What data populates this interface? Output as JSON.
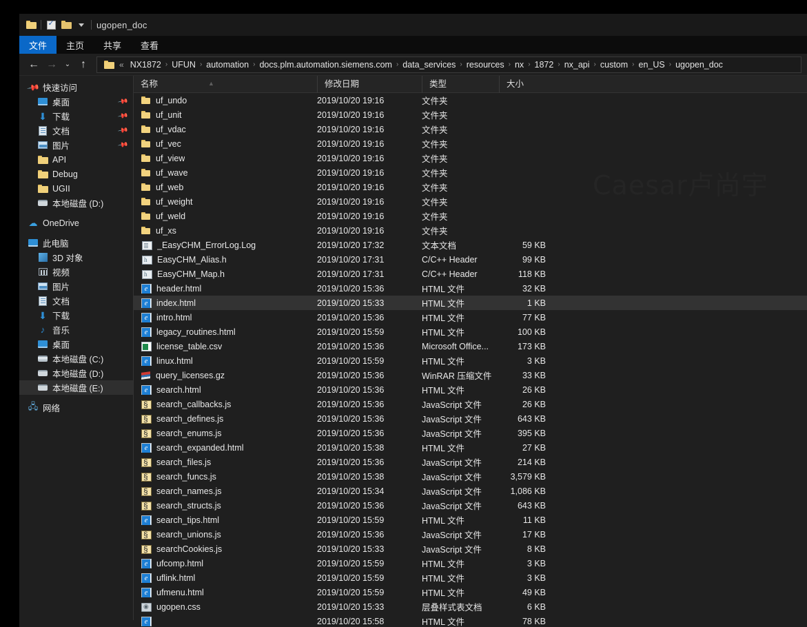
{
  "window": {
    "title": "ugopen_doc",
    "quick_access": [
      {
        "name": "folder-icon",
        "label": "folder"
      },
      {
        "name": "properties-checkbox-icon",
        "label": "properties"
      },
      {
        "name": "new-folder-icon",
        "label": "new folder"
      },
      {
        "name": "customize-qat-caret-icon",
        "label": "customize"
      }
    ]
  },
  "ribbon": {
    "tabs": [
      {
        "label": "文件",
        "active": true
      },
      {
        "label": "主页",
        "active": false
      },
      {
        "label": "共享",
        "active": false
      },
      {
        "label": "查看",
        "active": false
      }
    ]
  },
  "address": {
    "back_icon": "←",
    "forward_icon": "→",
    "history_icon": "⌄",
    "up_icon": "↑",
    "overflow": "«",
    "separator": "›",
    "crumbs": [
      "NX1872",
      "UFUN",
      "automation",
      "docs.plm.automation.siemens.com",
      "data_services",
      "resources",
      "nx",
      "1872",
      "nx_api",
      "custom",
      "en_US",
      "ugopen_doc"
    ]
  },
  "sidebar": {
    "groups": [
      {
        "header": {
          "label": "快速访问",
          "icon": "pin-icon"
        },
        "items": [
          {
            "label": "桌面",
            "icon": "desktop-icon",
            "pinned": true
          },
          {
            "label": "下载",
            "icon": "downloads-icon",
            "pinned": true
          },
          {
            "label": "文档",
            "icon": "documents-icon",
            "pinned": true
          },
          {
            "label": "图片",
            "icon": "pictures-icon",
            "pinned": true
          },
          {
            "label": "API",
            "icon": "folder-icon",
            "pinned": false
          },
          {
            "label": "Debug",
            "icon": "folder-icon",
            "pinned": false
          },
          {
            "label": "UGII",
            "icon": "folder-icon",
            "pinned": false
          },
          {
            "label": "本地磁盘 (D:)",
            "icon": "drive-icon",
            "pinned": false
          }
        ]
      },
      {
        "header": {
          "label": "OneDrive",
          "icon": "cloud-icon"
        },
        "items": []
      },
      {
        "header": {
          "label": "此电脑",
          "icon": "this-pc-icon"
        },
        "items": [
          {
            "label": "3D 对象",
            "icon": "3d-objects-icon",
            "pinned": false
          },
          {
            "label": "视频",
            "icon": "videos-icon",
            "pinned": false
          },
          {
            "label": "图片",
            "icon": "pictures-icon",
            "pinned": false
          },
          {
            "label": "文档",
            "icon": "documents-icon",
            "pinned": false
          },
          {
            "label": "下载",
            "icon": "downloads-icon",
            "pinned": false
          },
          {
            "label": "音乐",
            "icon": "music-icon",
            "pinned": false
          },
          {
            "label": "桌面",
            "icon": "desktop-icon",
            "pinned": false
          },
          {
            "label": "本地磁盘 (C:)",
            "icon": "system-drive-icon",
            "pinned": false
          },
          {
            "label": "本地磁盘 (D:)",
            "icon": "drive-icon",
            "pinned": false
          },
          {
            "label": "本地磁盘 (E:)",
            "icon": "drive-icon",
            "pinned": false,
            "selected": true
          }
        ]
      },
      {
        "header": {
          "label": "网络",
          "icon": "network-icon"
        },
        "items": []
      }
    ]
  },
  "file_list": {
    "columns": [
      {
        "label": "名称",
        "key": "name",
        "sorted": "asc"
      },
      {
        "label": "修改日期",
        "key": "date"
      },
      {
        "label": "类型",
        "key": "type"
      },
      {
        "label": "大小",
        "key": "size"
      }
    ],
    "rows": [
      {
        "name": "uf_undo",
        "date": "2019/10/20 19:16",
        "type": "文件夹",
        "size": "",
        "icon": "folder"
      },
      {
        "name": "uf_unit",
        "date": "2019/10/20 19:16",
        "type": "文件夹",
        "size": "",
        "icon": "folder"
      },
      {
        "name": "uf_vdac",
        "date": "2019/10/20 19:16",
        "type": "文件夹",
        "size": "",
        "icon": "folder"
      },
      {
        "name": "uf_vec",
        "date": "2019/10/20 19:16",
        "type": "文件夹",
        "size": "",
        "icon": "folder"
      },
      {
        "name": "uf_view",
        "date": "2019/10/20 19:16",
        "type": "文件夹",
        "size": "",
        "icon": "folder"
      },
      {
        "name": "uf_wave",
        "date": "2019/10/20 19:16",
        "type": "文件夹",
        "size": "",
        "icon": "folder"
      },
      {
        "name": "uf_web",
        "date": "2019/10/20 19:16",
        "type": "文件夹",
        "size": "",
        "icon": "folder"
      },
      {
        "name": "uf_weight",
        "date": "2019/10/20 19:16",
        "type": "文件夹",
        "size": "",
        "icon": "folder"
      },
      {
        "name": "uf_weld",
        "date": "2019/10/20 19:16",
        "type": "文件夹",
        "size": "",
        "icon": "folder"
      },
      {
        "name": "uf_xs",
        "date": "2019/10/20 19:16",
        "type": "文件夹",
        "size": "",
        "icon": "folder"
      },
      {
        "name": "_EasyCHM_ErrorLog.Log",
        "date": "2019/10/20 17:32",
        "type": "文本文档",
        "size": "59 KB",
        "icon": "txt"
      },
      {
        "name": "EasyCHM_Alias.h",
        "date": "2019/10/20 17:31",
        "type": "C/C++ Header",
        "size": "99 KB",
        "icon": "h"
      },
      {
        "name": "EasyCHM_Map.h",
        "date": "2019/10/20 17:31",
        "type": "C/C++ Header",
        "size": "118 KB",
        "icon": "h"
      },
      {
        "name": "header.html",
        "date": "2019/10/20 15:36",
        "type": "HTML 文件",
        "size": "32 KB",
        "icon": "html"
      },
      {
        "name": "index.html",
        "date": "2019/10/20 15:33",
        "type": "HTML 文件",
        "size": "1 KB",
        "icon": "html",
        "selected": true
      },
      {
        "name": "intro.html",
        "date": "2019/10/20 15:36",
        "type": "HTML 文件",
        "size": "77 KB",
        "icon": "html"
      },
      {
        "name": "legacy_routines.html",
        "date": "2019/10/20 15:59",
        "type": "HTML 文件",
        "size": "100 KB",
        "icon": "html"
      },
      {
        "name": "license_table.csv",
        "date": "2019/10/20 15:36",
        "type": "Microsoft Office...",
        "size": "173 KB",
        "icon": "csv"
      },
      {
        "name": "linux.html",
        "date": "2019/10/20 15:59",
        "type": "HTML 文件",
        "size": "3 KB",
        "icon": "html"
      },
      {
        "name": "query_licenses.gz",
        "date": "2019/10/20 15:36",
        "type": "WinRAR 压缩文件",
        "size": "33 KB",
        "icon": "gz"
      },
      {
        "name": "search.html",
        "date": "2019/10/20 15:36",
        "type": "HTML 文件",
        "size": "26 KB",
        "icon": "html"
      },
      {
        "name": "search_callbacks.js",
        "date": "2019/10/20 15:36",
        "type": "JavaScript 文件",
        "size": "26 KB",
        "icon": "js"
      },
      {
        "name": "search_defines.js",
        "date": "2019/10/20 15:36",
        "type": "JavaScript 文件",
        "size": "643 KB",
        "icon": "js"
      },
      {
        "name": "search_enums.js",
        "date": "2019/10/20 15:36",
        "type": "JavaScript 文件",
        "size": "395 KB",
        "icon": "js"
      },
      {
        "name": "search_expanded.html",
        "date": "2019/10/20 15:38",
        "type": "HTML 文件",
        "size": "27 KB",
        "icon": "html"
      },
      {
        "name": "search_files.js",
        "date": "2019/10/20 15:36",
        "type": "JavaScript 文件",
        "size": "214 KB",
        "icon": "js"
      },
      {
        "name": "search_funcs.js",
        "date": "2019/10/20 15:38",
        "type": "JavaScript 文件",
        "size": "3,579 KB",
        "icon": "js"
      },
      {
        "name": "search_names.js",
        "date": "2019/10/20 15:34",
        "type": "JavaScript 文件",
        "size": "1,086 KB",
        "icon": "js"
      },
      {
        "name": "search_structs.js",
        "date": "2019/10/20 15:36",
        "type": "JavaScript 文件",
        "size": "643 KB",
        "icon": "js"
      },
      {
        "name": "search_tips.html",
        "date": "2019/10/20 15:59",
        "type": "HTML 文件",
        "size": "11 KB",
        "icon": "html"
      },
      {
        "name": "search_unions.js",
        "date": "2019/10/20 15:36",
        "type": "JavaScript 文件",
        "size": "17 KB",
        "icon": "js"
      },
      {
        "name": "searchCookies.js",
        "date": "2019/10/20 15:33",
        "type": "JavaScript 文件",
        "size": "8 KB",
        "icon": "js"
      },
      {
        "name": "ufcomp.html",
        "date": "2019/10/20 15:59",
        "type": "HTML 文件",
        "size": "3 KB",
        "icon": "html"
      },
      {
        "name": "uflink.html",
        "date": "2019/10/20 15:59",
        "type": "HTML 文件",
        "size": "3 KB",
        "icon": "html"
      },
      {
        "name": "ufmenu.html",
        "date": "2019/10/20 15:59",
        "type": "HTML 文件",
        "size": "49 KB",
        "icon": "html"
      },
      {
        "name": "ugopen.css",
        "date": "2019/10/20 15:33",
        "type": "层叠样式表文档",
        "size": "6 KB",
        "icon": "css"
      },
      {
        "name": "",
        "date": "2019/10/20 15:58",
        "type": "HTML 文件",
        "size": "78 KB",
        "icon": "html"
      }
    ]
  },
  "watermark": {
    "text": "Caesar卢尚宇"
  }
}
